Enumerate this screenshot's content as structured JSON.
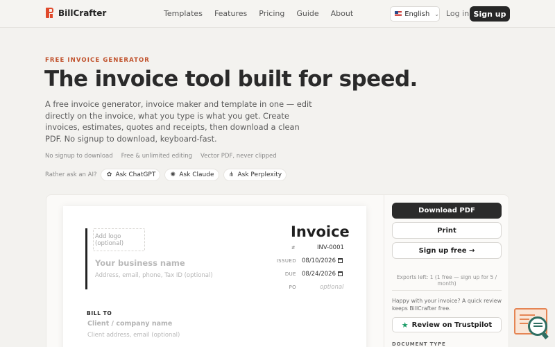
{
  "nav": {
    "brand": "BillCrafter",
    "links": [
      "Templates",
      "Features",
      "Pricing",
      "Guide",
      "About"
    ],
    "language": "English",
    "login": "Log in",
    "signup": "Sign up"
  },
  "hero": {
    "eyebrow": "FREE INVOICE GENERATOR",
    "headline": "The invoice tool built for speed.",
    "lead": "A free invoice generator, invoice maker and template in one — edit directly on the invoice, what you type is what you get. Create invoices, estimates, quotes and receipts, then download a clean PDF. No signup to download, keyboard-fast.",
    "features": [
      "No signup to download",
      "Free & unlimited editing",
      "Vector PDF, never clipped"
    ],
    "ask_label": "Rather ask an AI?",
    "ask_buttons": [
      "Ask ChatGPT",
      "Ask Claude",
      "Ask Perplexity"
    ]
  },
  "invoice": {
    "logo_placeholder": "Add logo (optional)",
    "business_name_placeholder": "Your business name",
    "business_address_placeholder": "Address, email, phone, Tax ID (optional)",
    "title": "Invoice",
    "number_label": "#",
    "number": "INV-0001",
    "issued_label": "ISSUED",
    "issued": "08/10/2026",
    "due_label": "DUE",
    "due": "08/24/2026",
    "po_label": "PO",
    "po_placeholder": "optional",
    "bill_to_label": "BILL TO",
    "client_name_placeholder": "Client / company name",
    "client_address_placeholder": "Client address, email (optional)"
  },
  "sidebar": {
    "download": "Download PDF",
    "print": "Print",
    "signup_free": "Sign up free →",
    "exports_note": "Exports left: 1 (1 free — sign up for 5 / month)",
    "review_prompt": "Happy with your invoice? A quick review keeps BillCrafter free.",
    "trustpilot": "Review on Trustpilot",
    "document_type_label": "DOCUMENT TYPE"
  },
  "colors": {
    "accent": "#c0512b",
    "dark": "#262626",
    "trustpilot_star": "#1a9c66"
  }
}
